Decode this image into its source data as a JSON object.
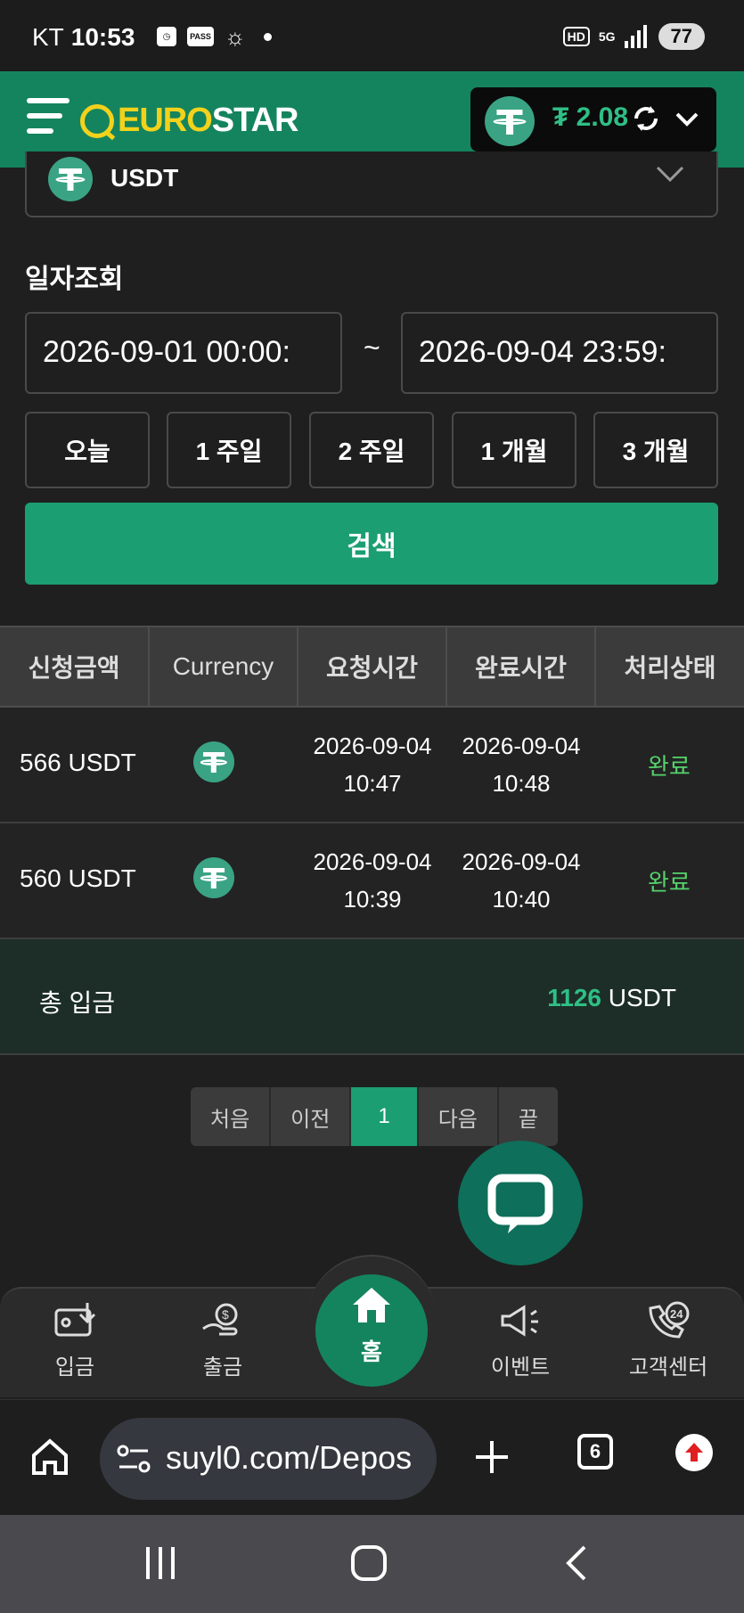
{
  "status_bar": {
    "carrier": "KT",
    "time": "10:53",
    "pass_label": "PASS",
    "hd_label": "HD",
    "network": "5G",
    "battery": "77"
  },
  "header": {
    "logo_euro": "EURO",
    "logo_star": "STAR",
    "balance": "₮ 2.08"
  },
  "currency_select": {
    "selected": "USDT"
  },
  "filter": {
    "section_title": "일자조회",
    "start_date": "2026-09-01 00:00:",
    "end_date": "2026-09-04 23:59:",
    "separator": "~",
    "quick_ranges": [
      "오늘",
      "1 주일",
      "2 주일",
      "1 개월",
      "3 개월"
    ],
    "search_label": "검색"
  },
  "table": {
    "headers": [
      "신청금액",
      "Currency",
      "요청시간",
      "완료시간",
      "처리상태"
    ],
    "rows": [
      {
        "amount": "566 USDT",
        "req_date": "2026-09-04",
        "req_time": "10:47",
        "done_date": "2026-09-04",
        "done_time": "10:48",
        "status": "완료"
      },
      {
        "amount": "560 USDT",
        "req_date": "2026-09-04",
        "req_time": "10:39",
        "done_date": "2026-09-04",
        "done_time": "10:40",
        "status": "완료"
      }
    ]
  },
  "total": {
    "label": "총 입금",
    "value": "1126",
    "unit": "USDT"
  },
  "pagination": {
    "first": "처음",
    "prev": "이전",
    "current": "1",
    "next": "다음",
    "last": "끝"
  },
  "bottom_nav": {
    "deposit": "입금",
    "withdraw": "출금",
    "home": "홈",
    "event": "이벤트",
    "support": "고객센터",
    "support_badge": "24"
  },
  "browser": {
    "url": "suyl0.com/Depos",
    "tab_count": "6"
  },
  "colors": {
    "brand_green": "#14845e",
    "accent": "#1a9e72",
    "logo_yellow": "#f2d21b",
    "status_done": "#55d36c"
  }
}
